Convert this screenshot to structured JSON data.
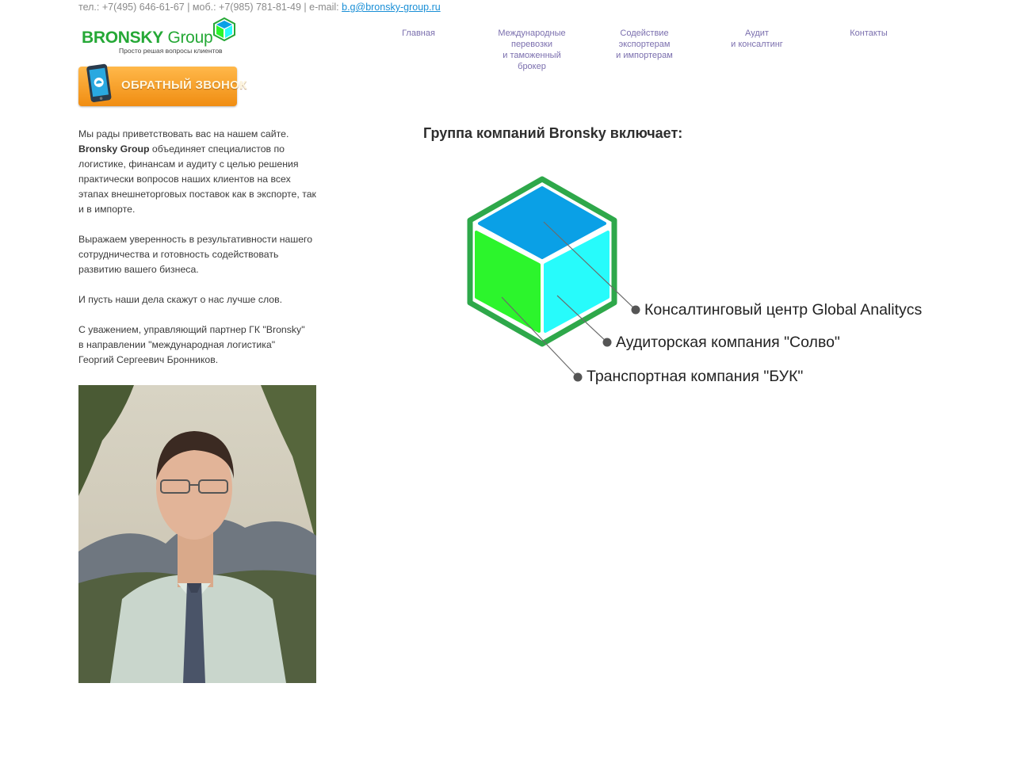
{
  "contact": {
    "prefix": "тел.: +7(495) 646-61-67 | моб.: +7(985) 781-81-49 | e-mail: ",
    "email": "b.g@bronsky-group.ru"
  },
  "logo": {
    "brand_bold": "BRONSKY",
    "brand_rest": " Group",
    "slogan": "Просто решая вопросы клиентов"
  },
  "callback": {
    "label": "ОБРАТНЫЙ ЗВОНОК"
  },
  "nav": [
    {
      "label": "Главная"
    },
    {
      "label": "Международные\nперевозки\nи таможенный\nброкер"
    },
    {
      "label": "Содействие\nэкспортерам\nи импортерам"
    },
    {
      "label": "Аудит\nи консалтинг"
    },
    {
      "label": "Контакты"
    }
  ],
  "intro": {
    "p1_start": "Мы рады приветствовать вас на нашем сайте.",
    "p1_bold": "Bronsky Group",
    "p1_rest": " объединяет специалистов по логистике, финансам и аудиту с целью решения практически вопросов наших клиентов на всех этапах внешнеторговых поставок как в экспорте, так и в импорте.",
    "p2": "Выражаем уверенность в результативности нашего сотрудничества и готовность содействовать развитию вашего бизнеса.",
    "p3": "И пусть наши дела скажут о нас лучше слов.",
    "p4_line1": "С уважением, управляющий партнер ГК \"Bronsky\"",
    "p4_line2": "в направлении \"международная логистика\"",
    "p4_line3": "Георгий Сергеевич Бронников."
  },
  "heading": "Группа компаний Bronsky включает:",
  "companies": [
    {
      "label": "Консалтинговый центр Global Analitycs"
    },
    {
      "label": "Аудиторская компания \"Солво\""
    },
    {
      "label": "Транспортная компания \"БУК\""
    }
  ],
  "colors": {
    "brand_green": "#25a836",
    "cube_top": "#0aa0e6",
    "cube_left": "#2cf52c",
    "cube_right": "#27fbfb",
    "nav_text": "#7b6fae",
    "button_orange": "#f5a12b"
  }
}
